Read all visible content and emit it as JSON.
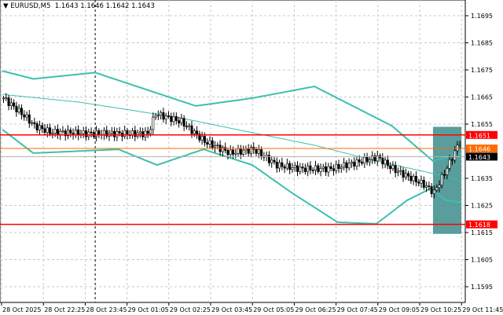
{
  "header": {
    "arrow_icon": "triangle-down-icon",
    "symbol": "EURUSD,M5",
    "open": "1.1643",
    "high": "1.1646",
    "low": "1.1642",
    "close": "1.1643"
  },
  "chart_data": {
    "type": "candlestick",
    "symbol": "EURUSD",
    "timeframe": "M5",
    "ylim": [
      1.159,
      1.1706
    ],
    "y_ticks": [
      "1.1695",
      "1.1685",
      "1.1675",
      "1.1665",
      "1.1655",
      "1.1635",
      "1.1625",
      "1.1615",
      "1.1605",
      "1.1595"
    ],
    "x_ticks": [
      "28 Oct 2025",
      "28 Oct 22:25",
      "28 Oct 23:45",
      "29 Oct 01:05",
      "29 Oct 02:25",
      "29 Oct 03:45",
      "29 Oct 05:05",
      "29 Oct 06:25",
      "29 Oct 07:45",
      "29 Oct 09:05",
      "29 Oct 10:25",
      "29 Oct 11:45"
    ],
    "bars_total": 178,
    "close_keypoints": [
      [
        0,
        1.16646
      ],
      [
        9,
        1.16573
      ],
      [
        12,
        1.16544
      ],
      [
        18,
        1.16521
      ],
      [
        33,
        1.16515
      ],
      [
        56,
        1.16515
      ],
      [
        59,
        1.16588
      ],
      [
        69,
        1.16559
      ],
      [
        78,
        1.16486
      ],
      [
        88,
        1.16443
      ],
      [
        97,
        1.16457
      ],
      [
        106,
        1.16399
      ],
      [
        115,
        1.16385
      ],
      [
        127,
        1.16385
      ],
      [
        145,
        1.16428
      ],
      [
        151,
        1.16385
      ],
      [
        163,
        1.16327
      ],
      [
        167,
        1.16298
      ],
      [
        171,
        1.1637
      ],
      [
        174,
        1.16428
      ],
      [
        177,
        1.16486
      ]
    ],
    "bb_upper": [
      [
        0,
        1.16746
      ],
      [
        12,
        1.16717
      ],
      [
        36,
        1.1674
      ],
      [
        75,
        1.16617
      ],
      [
        97,
        1.16646
      ],
      [
        121,
        1.16689
      ],
      [
        151,
        1.16544
      ],
      [
        167,
        1.16414
      ],
      [
        178,
        1.16443
      ]
    ],
    "bb_middle": [
      [
        0,
        1.1666
      ],
      [
        30,
        1.16631
      ],
      [
        69,
        1.16573
      ],
      [
        91,
        1.1653
      ],
      [
        121,
        1.16472
      ],
      [
        145,
        1.16414
      ],
      [
        166,
        1.1637
      ],
      [
        178,
        1.16341
      ]
    ],
    "bb_lower": [
      [
        0,
        1.1653
      ],
      [
        12,
        1.16443
      ],
      [
        45,
        1.16457
      ],
      [
        60,
        1.16399
      ],
      [
        78,
        1.16457
      ],
      [
        97,
        1.16399
      ],
      [
        112,
        1.16298
      ],
      [
        130,
        1.16188
      ],
      [
        145,
        1.16182
      ],
      [
        157,
        1.16269
      ],
      [
        166,
        1.16312
      ],
      [
        172,
        1.16269
      ],
      [
        178,
        1.16261
      ]
    ],
    "levels": [
      {
        "label": "1.1651",
        "price": 1.1651,
        "color": "#ff0000"
      },
      {
        "label": "1.1618",
        "price": 1.1618,
        "color": "#ff0000"
      },
      {
        "label": "1.1646",
        "price": 1.1646,
        "color": "#ff6a00"
      },
      {
        "label": "1.1643",
        "price": 1.1643,
        "color": "#000000"
      }
    ],
    "highlight": {
      "from_bar": 167,
      "to_bar": 178,
      "price_top": 1.1654,
      "price_bottom": 1.16145,
      "color": "#3d8c8c"
    },
    "vline_bar": 36,
    "band_color": "#3cbfb0"
  }
}
